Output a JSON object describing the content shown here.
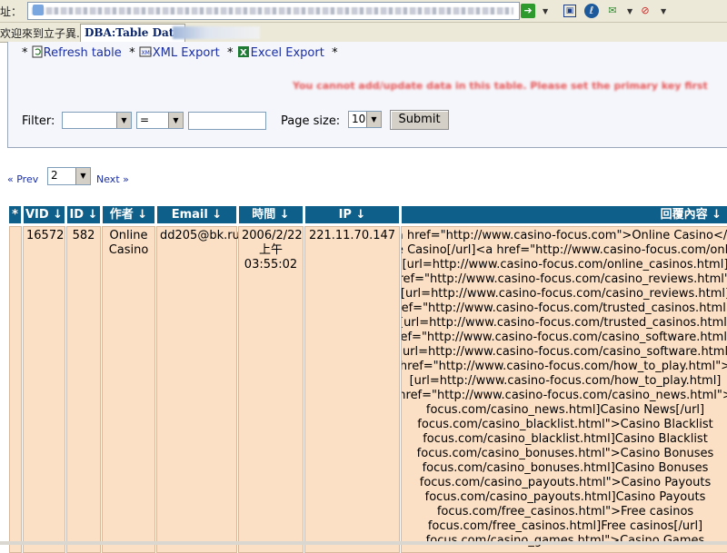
{
  "address_bar": {
    "label": "址：",
    "url_visible": false
  },
  "tabs": {
    "inactive_label": "欢迎來到立子異...",
    "active_label": "DBA:Table Data"
  },
  "actions": {
    "refresh": "Refresh table",
    "xml": "XML Export",
    "excel": "Excel Export",
    "sep": "*"
  },
  "warning": "You cannot add/update data in this table. Please set the primary key first",
  "filter": {
    "label": "Filter:",
    "field_value": "",
    "operator_value": "=",
    "text_value": "",
    "page_size_label": "Page size:",
    "page_size_value": "10",
    "submit_label": "Submit"
  },
  "pager": {
    "prev_label": "« Prev",
    "page_value": "2",
    "next_label": "Next »"
  },
  "table": {
    "headers": [
      "*",
      "VID ↓",
      "ID ↓",
      "作者 ↓",
      "Email ↓",
      "時間 ↓",
      "IP ↓",
      "回覆內容 ↓"
    ],
    "row": {
      "vid": "16572",
      "id": "582",
      "author": "Online Casino",
      "email": "dd205@bk.ru",
      "time_date": "2006/2/22",
      "time_ampm": "上午",
      "time_clock": "03:55:02",
      "ip": "221.11.70.147",
      "content_lines": [
        "<a href=\"http://www.casino-focus.com\">Online Casino</a>",
        "Online Casino[/url]<a href=\"http://www.casino-focus.com/online_casinos.html\">",
        "[url=http://www.casino-focus.com/online_casinos.html]",
        "href=\"http://www.casino-focus.com/casino_reviews.html\">",
        "[url=http://www.casino-focus.com/casino_reviews.html]",
        "href=\"http://www.casino-focus.com/trusted_casinos.html\">",
        "[url=http://www.casino-focus.com/trusted_casinos.html]",
        "href=\"http://www.casino-focus.com/casino_software.html\">",
        "[url=http://www.casino-focus.com/casino_software.html]",
        "href=\"http://www.casino-focus.com/how_to_play.html\">",
        "[url=http://www.casino-focus.com/how_to_play.html]",
        "href=\"http://www.casino-focus.com/casino_news.html\">",
        "focus.com/casino_news.html]Casino News[/url]",
        "focus.com/casino_blacklist.html\">Casino Blacklist",
        "focus.com/casino_blacklist.html]Casino Blacklist",
        "focus.com/casino_bonuses.html\">Casino Bonuses",
        "focus.com/casino_bonuses.html]Casino Bonuses",
        "focus.com/casino_payouts.html\">Casino Payouts",
        "focus.com/casino_payouts.html]Casino Payouts",
        "focus.com/free_casinos.html\">Free casinos",
        "focus.com/free_casinos.html]Free casinos[/url]",
        "focus.com/casino_games.html\">Casino Games"
      ]
    }
  }
}
